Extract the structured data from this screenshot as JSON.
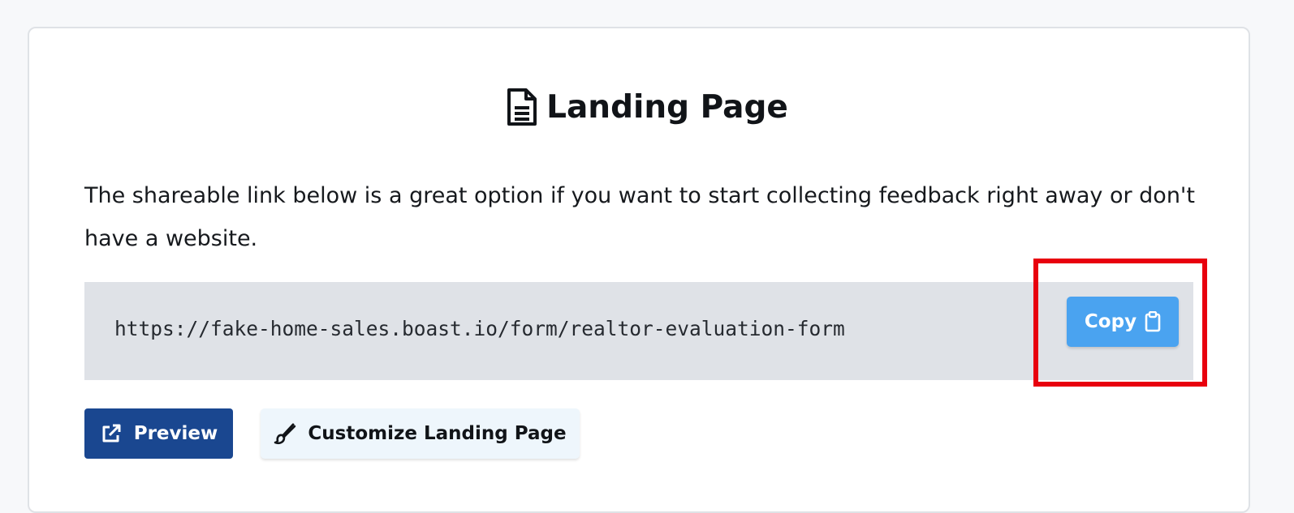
{
  "header": {
    "title": "Landing Page",
    "icon": "document-icon"
  },
  "description": "The shareable link below is a great option if you want to start collecting feedback right away or don't have a website.",
  "share_link": {
    "url": "https://fake-home-sales.boast.io/form/realtor-evaluation-form",
    "copy_label": "Copy",
    "copy_icon": "clipboard-icon"
  },
  "actions": {
    "preview_label": "Preview",
    "preview_icon": "external-link-icon",
    "customize_label": "Customize Landing Page",
    "customize_icon": "paintbrush-icon"
  },
  "colors": {
    "copy_button": "#4aa3f0",
    "preview_button": "#1a4790",
    "customize_button": "#eef6fc",
    "link_box": "#dfe2e7",
    "highlight": "#e8000e"
  }
}
